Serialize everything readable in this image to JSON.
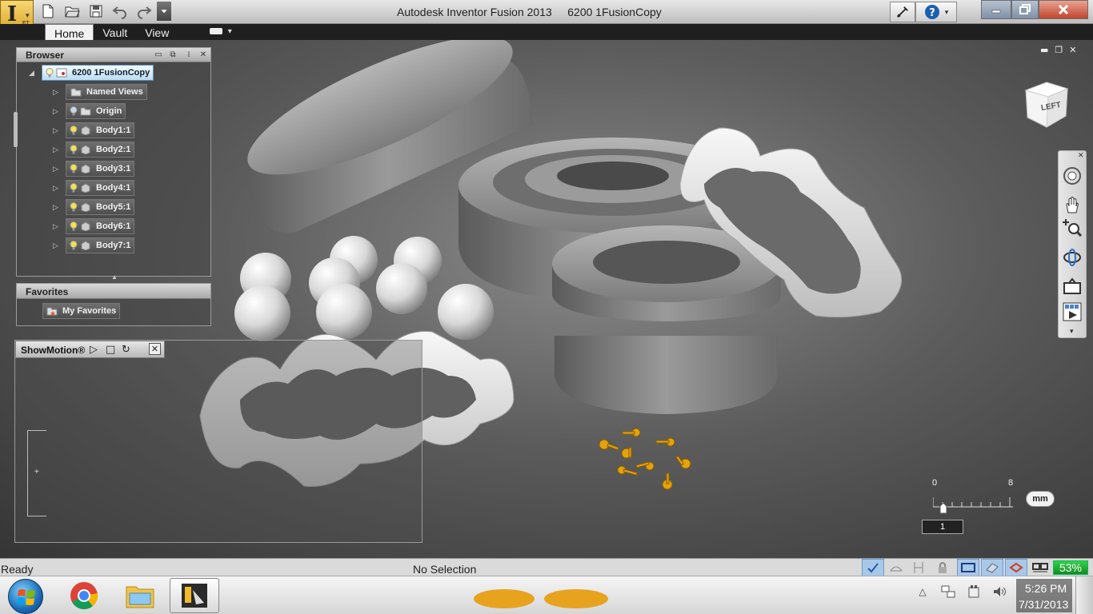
{
  "window": {
    "title": "Autodesk Inventor Fusion 2013",
    "document": "6200 1FusionCopy",
    "app_button_label": "FT"
  },
  "quick_access": {
    "icons": [
      "new-icon",
      "open-icon",
      "save-icon",
      "undo-icon",
      "redo-icon",
      "customize-dropdown-icon"
    ]
  },
  "ribbon": {
    "tabs": [
      {
        "label": "Home",
        "active": true
      },
      {
        "label": "Vault",
        "active": false
      },
      {
        "label": "View",
        "active": false
      }
    ]
  },
  "browser": {
    "title": "Browser",
    "root": {
      "label": "6200 1FusionCopy"
    },
    "nodes": [
      {
        "label": "Named Views"
      },
      {
        "label": "Origin"
      },
      {
        "label": "Body1:1"
      },
      {
        "label": "Body2:1"
      },
      {
        "label": "Body3:1"
      },
      {
        "label": "Body4:1"
      },
      {
        "label": "Body5:1"
      },
      {
        "label": "Body6:1"
      },
      {
        "label": "Body7:1"
      }
    ]
  },
  "favorites": {
    "title": "Favorites",
    "items": [
      {
        "label": "My Favorites"
      }
    ]
  },
  "showmotion": {
    "title": "ShowMotion®"
  },
  "viewcube": {
    "face": "LEFT"
  },
  "scale": {
    "min_label": "0",
    "max_label": "8",
    "unit": "mm",
    "value": "1"
  },
  "status": {
    "left": "Ready",
    "center": "No Selection",
    "battery": "53%"
  },
  "clock": {
    "time": "5:26 PM",
    "date": "7/31/2013"
  },
  "colors": {
    "accent_gold": "#d9a528",
    "selected_node": "#bcdcf2",
    "battery_green": "#22aa36",
    "rivets": "#e3a30d"
  }
}
